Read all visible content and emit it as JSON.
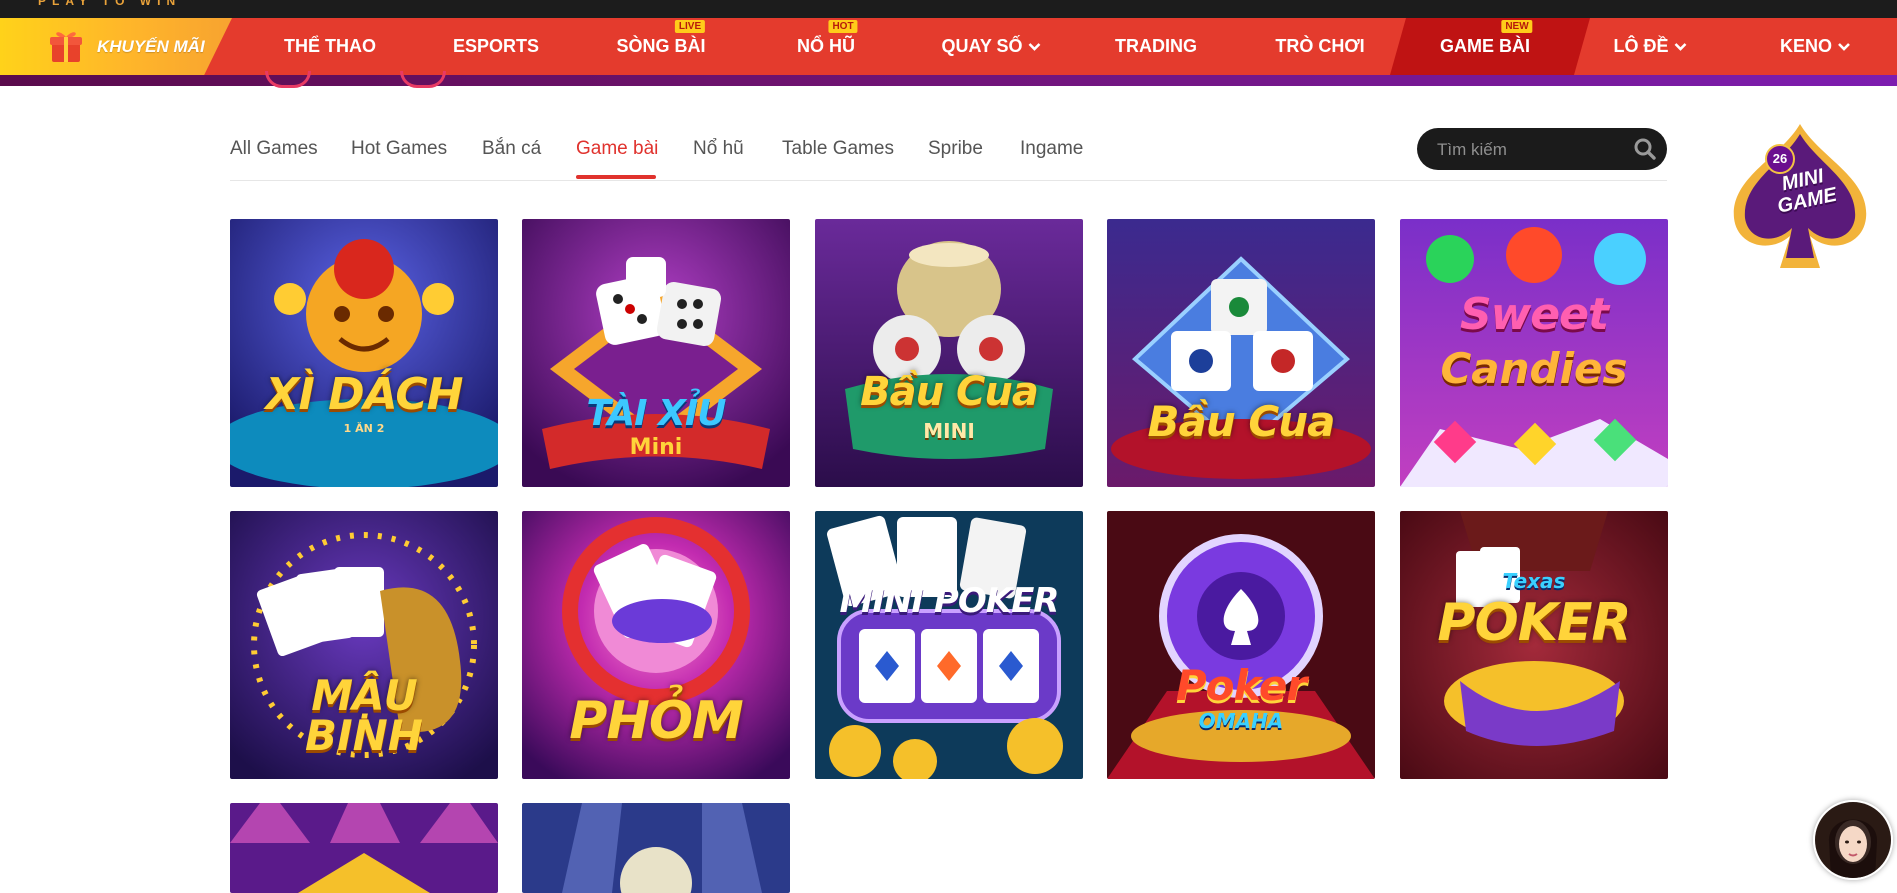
{
  "header": {
    "tagline": "PLAY TO WIN",
    "promo_label": "KHUYẾN MÃI",
    "nav": [
      {
        "label": "THỂ THAO"
      },
      {
        "label": "ESPORTS"
      },
      {
        "label": "SÒNG BÀI",
        "badge": "LIVE"
      },
      {
        "label": "NỔ HŨ",
        "badge": "HOT"
      },
      {
        "label": "QUAY SỐ"
      },
      {
        "label": "TRADING"
      },
      {
        "label": "TRÒ CHƠI"
      },
      {
        "label": "GAME BÀI",
        "badge": "NEW"
      },
      {
        "label": "LÔ ĐỀ"
      },
      {
        "label": "KENO"
      }
    ]
  },
  "tabs": [
    "All Games",
    "Hot Games",
    "Bắn cá",
    "Game bài",
    "Nổ hũ",
    "Table Games",
    "Spribe",
    "Ingame"
  ],
  "active_tab": "Game bài",
  "search": {
    "placeholder": "Tìm kiếm"
  },
  "games": [
    {
      "title": "XÌ DÁCH",
      "sub": "1 ĂN 2"
    },
    {
      "title": "TÀI XỈU",
      "sub": "Mini"
    },
    {
      "title": "Bầu Cua",
      "sub": "MINI"
    },
    {
      "title": "Bầu Cua",
      "sub": ""
    },
    {
      "title": "Sweet",
      "sub": "Candies"
    },
    {
      "title": "MẬU",
      "sub": "BINH"
    },
    {
      "title": "PHỎM",
      "sub": ""
    },
    {
      "title": "MINI POKER",
      "sub": ""
    },
    {
      "title": "Poker",
      "sub": "OMAHA"
    },
    {
      "title": "POKER",
      "sub": "Texas"
    }
  ],
  "minigame": {
    "count": "26",
    "line1": "MINI",
    "line2": "GAME"
  },
  "colors": {
    "nav_red": "#e43b2d",
    "nav_active": "#bf1313",
    "tab_active": "#e0322d",
    "badge_yellow": "#ffcc1a"
  }
}
